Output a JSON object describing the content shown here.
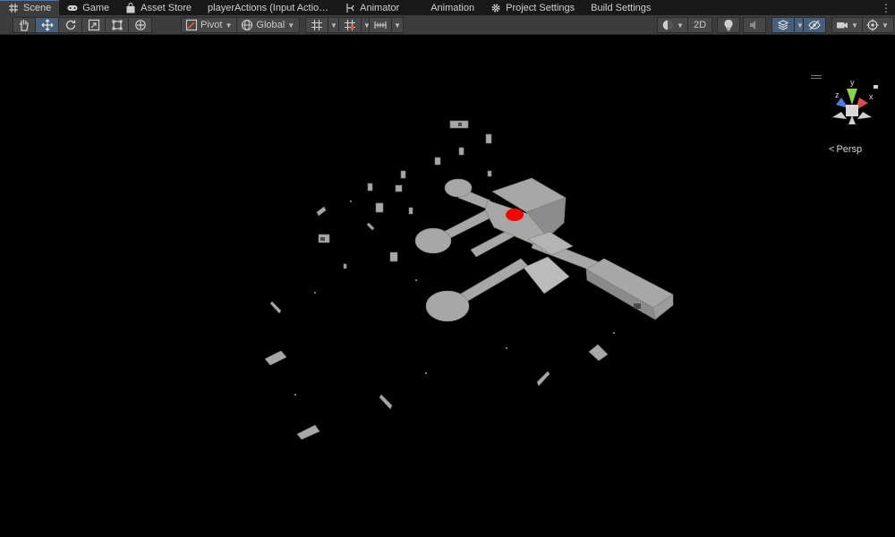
{
  "tabs": [
    {
      "label": "Scene",
      "icon": "grid-icon",
      "active": true
    },
    {
      "label": "Game",
      "icon": "gamepad-icon",
      "active": false
    },
    {
      "label": "Asset Store",
      "icon": "bag-icon",
      "active": false
    },
    {
      "label": "playerActions (Input Actio…",
      "icon": "",
      "active": false
    },
    {
      "label": "Animator",
      "icon": "animator-icon",
      "active": false
    },
    {
      "label": "Animation",
      "icon": "animation-icon",
      "active": false
    },
    {
      "label": "Project Settings",
      "icon": "gear-icon",
      "active": false
    },
    {
      "label": "Build Settings",
      "icon": "",
      "active": false
    }
  ],
  "tab_more_icon": "more-vertical-icon",
  "toolbar": {
    "pivot_label": "Pivot",
    "global_label": "Global",
    "mode_2d_label": "2D",
    "accent": "#46607c"
  },
  "gizmo": {
    "y_label": "y",
    "x_label": "x",
    "z_label": "z",
    "projection_label": "Persp",
    "colors": {
      "y": "#8bd34a",
      "x": "#e24a4a",
      "z": "#4b7fe0"
    }
  },
  "scene": {
    "background": "#000000",
    "geometry_color": "#a7a7a7",
    "marker_color": "#ff0000"
  }
}
